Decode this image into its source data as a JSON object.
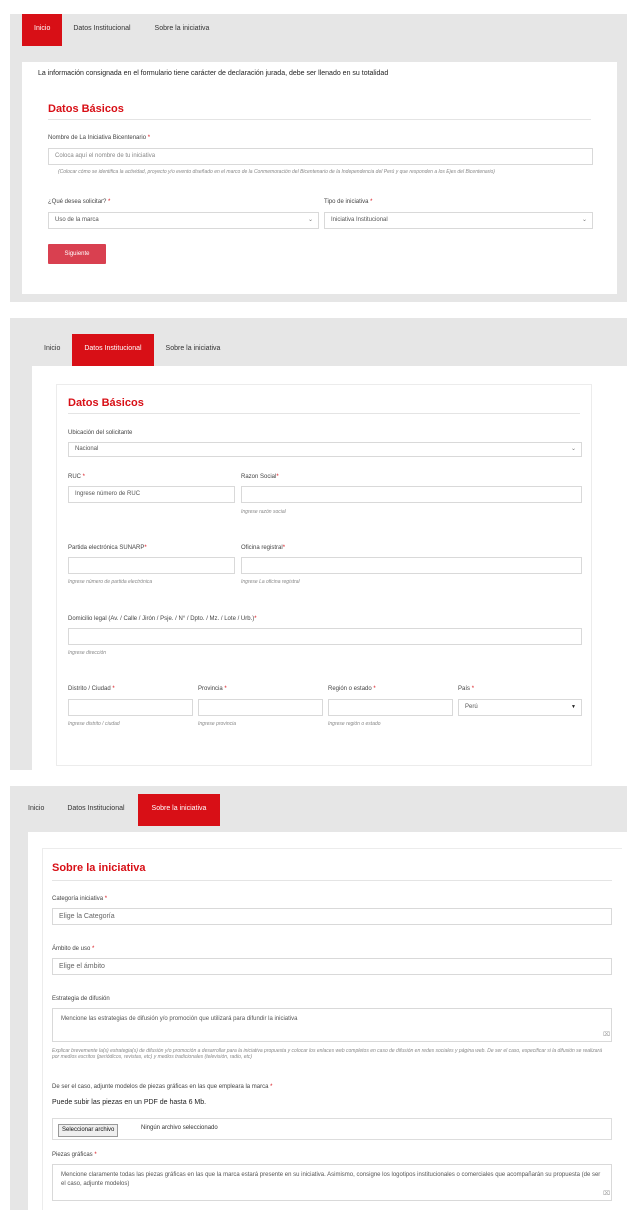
{
  "screen1": {
    "tabs": [
      "Inicio",
      "Datos Institucional",
      "Sobre la iniciativa"
    ],
    "notice": "La información consignada en el formulario tiene carácter de declaración jurada, debe ser llenado en su totalidad",
    "section_title": "Datos Básicos",
    "nombre_label": "Nombre de La Iniciativa Bicentenario",
    "nombre_placeholder": "Coloca aquí el nombre de tu iniciativa",
    "nombre_hint": "(Colocar cómo se identifica la actividad, proyecto y/o evento diseñado en el marco de la Conmemoración del Bicentenario de la Independencia del Perú y que responden a los Ejes del Bicentenario)",
    "solicitar_label": "¿Qué desea solicitar?",
    "solicitar_value": "Uso de la marca",
    "tipo_label": "Tipo de iniciativa",
    "tipo_value": "Iniciativa Institucional",
    "next_button": "Siguiente"
  },
  "screen2": {
    "tabs": [
      "Inicio",
      "Datos Institucional",
      "Sobre la iniciativa"
    ],
    "section_title": "Datos Básicos",
    "ubicacion_label": "Ubicación del solicitante",
    "ubicacion_value": "Nacional",
    "ruc_label": "RUC",
    "ruc_placeholder": "Ingrese número de RUC",
    "razon_label": "Razon Social",
    "razon_hint": "Ingrese razón social",
    "partida_label": "Partida electrónica SUNARP",
    "partida_hint": "Ingrese número de partida electrónica",
    "oficina_label": "Oficina registral",
    "oficina_hint": "Ingrese La oficina registral",
    "domicilio_label": "Domicilio legal (Av. / Calle / Jirón / Psje. / N° / Dpto. / Mz. / Lote / Urb.)",
    "domicilio_hint": "Ingrese dirección",
    "distrito_label": "Distrito / Ciudad",
    "distrito_hint": "Ingrese distrito / ciudad",
    "provincia_label": "Provincia",
    "provincia_hint": "Ingrese provincia",
    "region_label": "Región o estado",
    "region_hint": "Ingrese región o estado",
    "pais_label": "País",
    "pais_value": "Perú"
  },
  "screen3": {
    "tabs": [
      "Inicio",
      "Datos Institucional",
      "Sobre la iniciativa"
    ],
    "section_title": "Sobre la iniciativa",
    "categoria_label": "Categoría iniciativa",
    "categoria_placeholder": "Elige la Categoría",
    "ambito_label": "Ámbito de uso",
    "ambito_placeholder": "Elige el ámbito",
    "estrategia_label": "Estrategia de difusión",
    "estrategia_placeholder": "Mencione las estrategias de difusión y/o promoción que utilizará para difundir la iniciativa",
    "estrategia_hint": "Explicar brevemente la(s) estrategia(s) de difusión y/o promoción a desarrollar para la iniciativa propuesta y colocar los enlaces web completos en caso de difusión en redes sociales y página web. De ser el caso, especificar si la difusión se realizará por medios escritos (periódicos, revistas, etc) y medios tradicionales (televisión, radio, etc)",
    "modelos_label": "De ser el caso, adjunte modelos de piezas gráficas en las que empleara la marca",
    "modelos_note": "Puede subir las piezas en un PDF de hasta 6 Mb.",
    "file_button": "Seleccionar archivo",
    "file_status": "Ningún archivo seleccionado",
    "piezas_label": "Piezas gráficas",
    "piezas_placeholder": "Mencione claramente todas las piezas gráficas en las que la marca estará presente en su iniciativa. Asimismo, consigne los logotipos institucionales o comerciales que acompañarán su propuesta (de ser el caso, adjunte modelos)"
  },
  "icons": {
    "select_arrow": "chevron-down-icon",
    "dropdown_caret": "caret-down-icon",
    "resize_handle": "resize-handle-icon"
  },
  "colors": {
    "accent": "#d80f16",
    "button": "#d94050"
  }
}
